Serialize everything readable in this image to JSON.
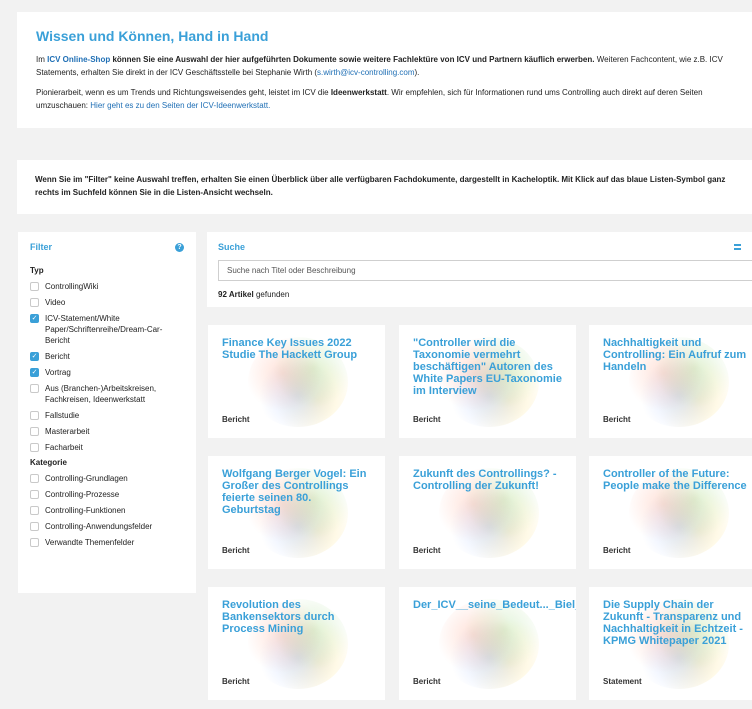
{
  "intro": {
    "title": "Wissen und Können, Hand in Hand",
    "p1_a": "Im ",
    "p1_link": "ICV Online-Shop",
    "p1_b": " können Sie eine Auswahl der hier aufgeführten Dokumente sowie weitere Fachlektüre von ICV und Partnern käuflich erwerben.",
    "p1_c": " Weiteren Fachcontent, wie z.B. ICV Statements, erhalten Sie direkt in der ICV Geschäftsstelle bei Stephanie Wirth (",
    "p1_email": "s.wirth@icv-controlling.com",
    "p1_d": ").",
    "p2_a": "Pionierarbeit, wenn es um Trends und Richtungsweisendes geht, leistet im ICV die ",
    "p2_bold": "Ideenwerkstatt",
    "p2_b": ". Wir empfehlen, sich für Informationen rund ums Controlling auch direkt auf deren Seiten umzuschauen: ",
    "p2_link": "Hier geht es zu den Seiten der ICV-Ideenwerkstatt."
  },
  "info": {
    "text": "Wenn Sie im \"Filter\" keine Auswahl treffen, erhalten Sie einen Überblick über alle verfügbaren Fachdokumente, dargestellt in Kacheloptik. Mit Klick auf das blaue Listen-Symbol ganz rechts im Suchfeld können Sie in die Listen-Ansicht wechseln."
  },
  "filter": {
    "title": "Filter",
    "typ_title": "Typ",
    "typ": [
      {
        "label": "ControllingWiki",
        "checked": false
      },
      {
        "label": "Video",
        "checked": false
      },
      {
        "label": "ICV-Statement/White Paper/Schriftenreihe/Dream-Car-Bericht",
        "checked": true
      },
      {
        "label": "Bericht",
        "checked": true
      },
      {
        "label": "Vortrag",
        "checked": true
      },
      {
        "label": "Aus (Branchen-)Arbeitskreisen, Fachkreisen, Ideenwerkstatt",
        "checked": false
      },
      {
        "label": "Fallstudie",
        "checked": false
      },
      {
        "label": "Masterarbeit",
        "checked": false
      },
      {
        "label": "Facharbeit",
        "checked": false
      }
    ],
    "kategorie_title": "Kategorie",
    "kategorie": [
      {
        "label": "Controlling-Grundlagen",
        "checked": false
      },
      {
        "label": "Controlling-Prozesse",
        "checked": false
      },
      {
        "label": "Controlling-Funktionen",
        "checked": false
      },
      {
        "label": "Controlling-Anwendungsfelder",
        "checked": false
      },
      {
        "label": "Verwandte Themenfelder",
        "checked": false
      }
    ]
  },
  "search": {
    "title": "Suche",
    "placeholder": "Suche nach Titel oder Beschreibung",
    "count": "92 Artikel",
    "count_suffix": " gefunden"
  },
  "cards": [
    {
      "title": "Finance Key Issues 2022 Studie The Hackett Group",
      "type": "Bericht"
    },
    {
      "title": "\"Controller wird die Taxonomie vermehrt beschäftigen\" Autoren des White Papers EU-Taxonomie im Interview",
      "type": "Bericht"
    },
    {
      "title": "Nachhaltigkeit und Controlling: Ein Aufruf zum Handeln",
      "type": "Bericht"
    },
    {
      "title": "Wolfgang Berger Vogel: Ein Großer des Controllings feierte seinen 80. Geburtstag",
      "type": "Bericht"
    },
    {
      "title": "Zukunft des Controllings? - Controlling der Zukunft!",
      "type": "Bericht"
    },
    {
      "title": "Controller of the Future: People make the Difference",
      "type": "Bericht"
    },
    {
      "title": "Revolution des Bankensektors durch Process Mining",
      "type": "Bericht"
    },
    {
      "title": "Der_ICV__seine_Bedeut..._Biel_im_Interview_mit_...",
      "type": "Bericht"
    },
    {
      "title": "Die Supply Chain der Zukunft - Transparenz und Nachhaltigkeit in Echtzeit - KPMG Whitepaper 2021",
      "type": "Statement"
    }
  ],
  "icons": {
    "help": "help-circle-icon",
    "list": "list-view-icon",
    "check": "checkmark-icon"
  },
  "colors": {
    "accent": "#3aa0d8",
    "link": "#1f6fb5",
    "background": "#f2f2f2"
  }
}
